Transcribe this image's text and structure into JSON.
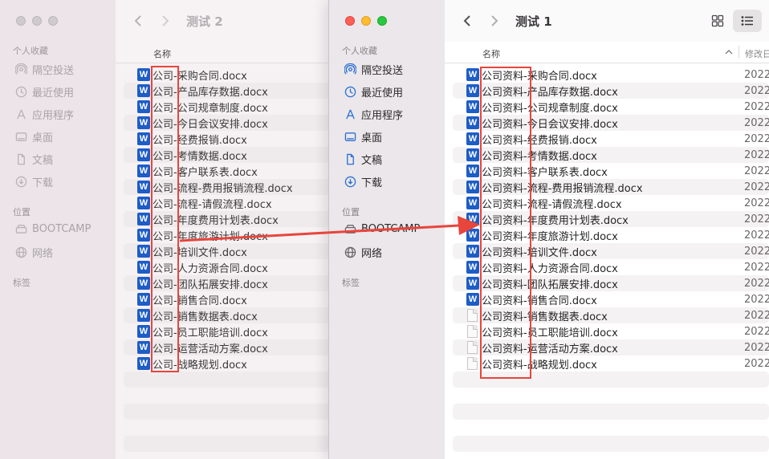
{
  "colors": {
    "accent": "#2a6fd6",
    "annotation": "#e8453c",
    "word_blue": "#1d5dc7"
  },
  "sidebar_sections": {
    "favorites": "个人收藏",
    "locations": "位置",
    "tags": "标签"
  },
  "sidebar_items": {
    "airdrop": "隔空投送",
    "recents": "最近使用",
    "applications": "应用程序",
    "desktop": "桌面",
    "documents": "文稿",
    "downloads": "下载",
    "bootcamp": "BOOTCAMP",
    "network": "网络"
  },
  "back_window": {
    "title": "测试 2",
    "col_name": "名称",
    "files": [
      "公司-采购合同.docx",
      "公司-产品库存数据.docx",
      "公司-公司规章制度.docx",
      "公司-今日会议安排.docx",
      "公司-经费报销.docx",
      "公司-考情数据.docx",
      "公司-客户联系表.docx",
      "公司-流程-费用报销流程.docx",
      "公司-流程-请假流程.docx",
      "公司-年度费用计划表.docx",
      "公司-年度旅游计划.docx",
      "公司-培训文件.docx",
      "公司-人力资源合同.docx",
      "公司-团队拓展安排.docx",
      "公司-销售合同.docx",
      "公司-销售数据表.docx",
      "公司-员工职能培训.docx",
      "公司-运营活动方案.docx",
      "公司-战略规划.docx"
    ]
  },
  "front_window": {
    "title": "测试 1",
    "col_name": "名称",
    "col_modified": "修改日",
    "date_prefix": "2022",
    "files": [
      {
        "name": "公司资料-采购合同.docx",
        "icon": "word"
      },
      {
        "name": "公司资料-产品库存数据.docx",
        "icon": "word"
      },
      {
        "name": "公司资料-公司规章制度.docx",
        "icon": "word"
      },
      {
        "name": "公司资料-今日会议安排.docx",
        "icon": "word"
      },
      {
        "name": "公司资料-经费报销.docx",
        "icon": "word"
      },
      {
        "name": "公司资料-考情数据.docx",
        "icon": "word"
      },
      {
        "name": "公司资料-客户联系表.docx",
        "icon": "word"
      },
      {
        "name": "公司资料-流程-费用报销流程.docx",
        "icon": "word"
      },
      {
        "name": "公司资料-流程-请假流程.docx",
        "icon": "word"
      },
      {
        "name": "公司资料-年度费用计划表.docx",
        "icon": "word"
      },
      {
        "name": "公司资料-年度旅游计划.docx",
        "icon": "word"
      },
      {
        "name": "公司资料-培训文件.docx",
        "icon": "word"
      },
      {
        "name": "公司资料-人力资源合同.docx",
        "icon": "word"
      },
      {
        "name": "公司资料-团队拓展安排.docx",
        "icon": "word"
      },
      {
        "name": "公司资料-销售合同.docx",
        "icon": "word"
      },
      {
        "name": "公司资料-销售数据表.docx",
        "icon": "generic"
      },
      {
        "name": "公司资料-员工职能培训.docx",
        "icon": "generic"
      },
      {
        "name": "公司资料-运营活动方案.docx",
        "icon": "generic"
      },
      {
        "name": "公司资料-战略规划.docx",
        "icon": "generic"
      }
    ]
  }
}
